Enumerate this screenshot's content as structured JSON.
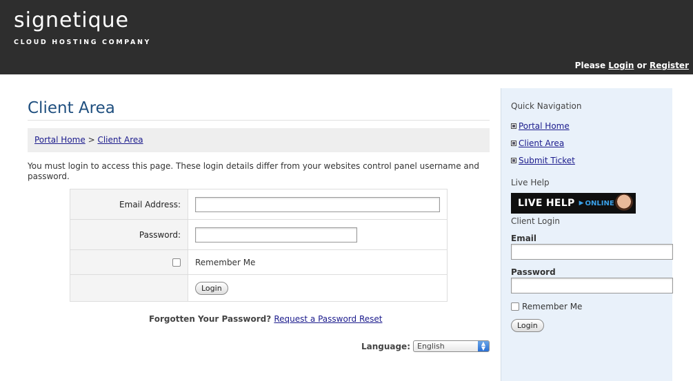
{
  "header": {
    "logo_text": "signetique",
    "logo_tagline": "CLOUD HOSTING COMPANY",
    "please_text": "Please",
    "login_link": "Login",
    "or_text": "or",
    "register_link": "Register"
  },
  "main": {
    "title": "Client Area",
    "breadcrumb": {
      "home": "Portal Home",
      "separator": ">",
      "current": "Client Area"
    },
    "intro": "You must login to access this page. These login details differ from your websites control panel username and password.",
    "form": {
      "email_label": "Email Address:",
      "email_value": "",
      "password_label": "Password:",
      "password_value": "",
      "remember_label": "Remember Me",
      "remember_checked": false,
      "login_button": "Login"
    },
    "forgot_text": "Forgotten Your Password?",
    "reset_link": "Request a Password Reset",
    "language_label": "Language:",
    "language_value": "English"
  },
  "sidebar": {
    "quick_nav_title": "Quick Navigation",
    "nav_items": [
      {
        "label": "Portal Home",
        "icon": "home-icon"
      },
      {
        "label": "Client Area",
        "icon": "client-area-icon"
      },
      {
        "label": "Submit Ticket",
        "icon": "ticket-icon"
      }
    ],
    "live_help_title": "Live Help",
    "live_help_banner": "LIVE HELP",
    "live_help_status": "ONLINE",
    "client_login_title": "Client Login",
    "email_label": "Email",
    "email_value": "",
    "password_label": "Password",
    "password_value": "",
    "remember_label": "Remember Me",
    "login_button": "Login"
  },
  "colors": {
    "header_bg": "#2e2e2e",
    "title_blue": "#1f4f7f",
    "sidebar_bg": "#e9f1fa",
    "link": "#1a1a8c"
  }
}
